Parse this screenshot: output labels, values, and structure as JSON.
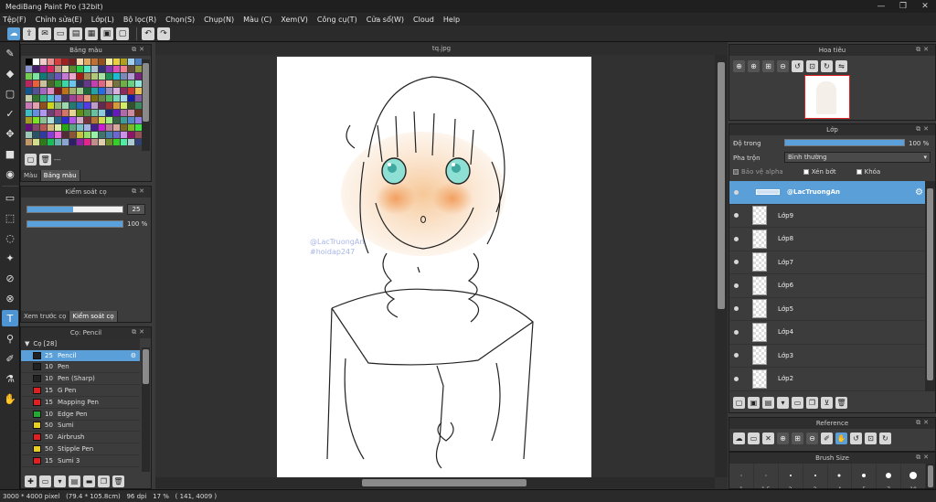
{
  "window": {
    "title": "MediBang Paint Pro (32bit)"
  },
  "menu": [
    "Tệp(F)",
    "Chỉnh sửa(E)",
    "Lớp(L)",
    "Bộ lọc(R)",
    "Chọn(S)",
    "Chụp(N)",
    "Màu (C)",
    "Xem(V)",
    "Công cụ(T)",
    "Cửa sổ(W)",
    "Cloud",
    "Help"
  ],
  "colorPanel": {
    "title": "Bảng màu",
    "extra": "---",
    "tabs": [
      "Màu",
      "Bảng màu"
    ]
  },
  "brushControl": {
    "title": "Kiểm soát cọ",
    "size": "25",
    "size_fill": 0.48,
    "opacity": "100 %",
    "opacity_fill": 1.0,
    "tabs": [
      "Xem trước cọ",
      "Kiểm soát cọ"
    ]
  },
  "brushPanel": {
    "title": "Cọ: Pencil",
    "group": "Cọ [28]",
    "items": [
      {
        "size": "25",
        "name": "Pencil",
        "color": "#222222",
        "selected": true
      },
      {
        "size": "10",
        "name": "Pen",
        "color": "#222222"
      },
      {
        "size": "10",
        "name": "Pen (Sharp)",
        "color": "#222222"
      },
      {
        "size": "15",
        "name": "G Pen",
        "color": "#e02020"
      },
      {
        "size": "15",
        "name": "Mapping Pen",
        "color": "#e02020"
      },
      {
        "size": "10",
        "name": "Edge Pen",
        "color": "#22aa33"
      },
      {
        "size": "50",
        "name": "Sumi",
        "color": "#e8d020"
      },
      {
        "size": "50",
        "name": "Airbrush",
        "color": "#e02020"
      },
      {
        "size": "50",
        "name": "Stipple Pen",
        "color": "#e8d020"
      },
      {
        "size": "15",
        "name": "Sumi 3",
        "color": "#e02020"
      }
    ]
  },
  "document": {
    "tab": "tq.jpg",
    "watermark": [
      "@LacTruongAn",
      "#hoidap247"
    ]
  },
  "navigator": {
    "title": "Hoa tiêu"
  },
  "layers": {
    "title": "Lớp",
    "opacity_label": "Độ trong",
    "opacity_value": "100 %",
    "opacity_fill": 1.0,
    "blend_label": "Pha trộn",
    "blend_value": "Bình thường",
    "protect_alpha": "Bảo vệ alpha",
    "clipping": "Xén bớt",
    "lock": "Khóa",
    "items": [
      {
        "name": "@LacTruongAn",
        "selected": true
      },
      {
        "name": "Lớp9"
      },
      {
        "name": "Lớp8"
      },
      {
        "name": "Lớp7"
      },
      {
        "name": "Lớp6"
      },
      {
        "name": "Lớp5"
      },
      {
        "name": "Lớp4"
      },
      {
        "name": "Lớp3"
      },
      {
        "name": "Lớp2"
      }
    ]
  },
  "reference": {
    "title": "Reference"
  },
  "brushSize": {
    "title": "Brush Size",
    "sizes": [
      "1",
      "1.5",
      "2",
      "3",
      "4",
      "5",
      "7",
      "10"
    ]
  },
  "status": {
    "dimensions": "3000 * 4000 pixel",
    "physical": "(79.4 * 105.8cm)",
    "dpi": "96 dpi",
    "zoom": "17 %",
    "cursor": "( 141, 4009 )"
  },
  "colors": {
    "accent": "#5a9fd8",
    "panel": "#3c3c3c",
    "background": "#3a3a3a"
  }
}
